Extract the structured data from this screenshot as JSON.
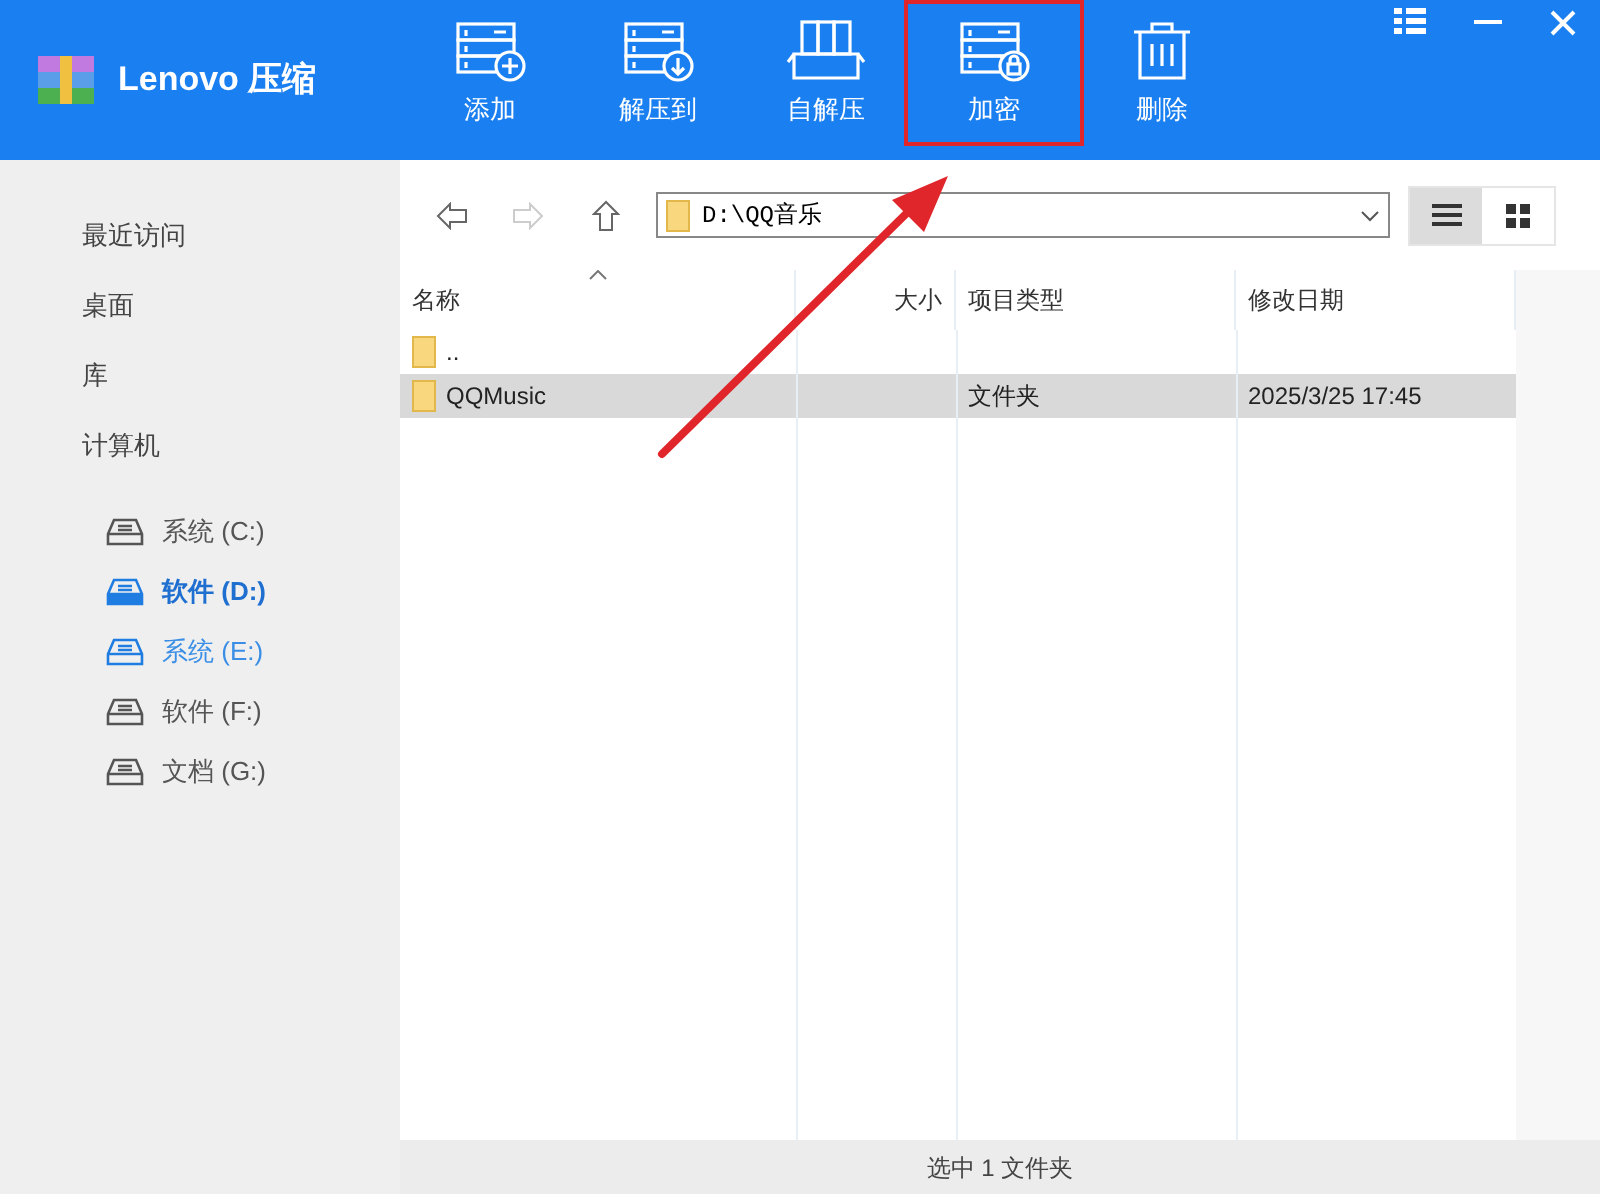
{
  "app": {
    "title": "Lenovo 压缩"
  },
  "toolbar": [
    {
      "kind": "add",
      "label": "添加",
      "highlighted": false
    },
    {
      "kind": "extract",
      "label": "解压到",
      "highlighted": false
    },
    {
      "kind": "sfx",
      "label": "自解压",
      "highlighted": false
    },
    {
      "kind": "encrypt",
      "label": "加密",
      "highlighted": true
    },
    {
      "kind": "delete",
      "label": "删除",
      "highlighted": false
    }
  ],
  "sidebar": {
    "items": [
      "最近访问",
      "桌面",
      "库",
      "计算机"
    ],
    "drives": [
      {
        "label": "系统 (C:)",
        "selected": false,
        "hovered": false
      },
      {
        "label": "软件 (D:)",
        "selected": true,
        "hovered": false
      },
      {
        "label": "系统 (E:)",
        "selected": false,
        "hovered": true
      },
      {
        "label": "软件 (F:)",
        "selected": false,
        "hovered": false
      },
      {
        "label": "文档 (G:)",
        "selected": false,
        "hovered": false
      }
    ]
  },
  "path": {
    "value": "D:\\QQ音乐"
  },
  "view": [
    {
      "kind": "list",
      "selected": true
    },
    {
      "kind": "grid",
      "selected": false
    }
  ],
  "table": {
    "columns": [
      {
        "label": "名称",
        "sorted": true
      },
      {
        "label": "大小",
        "sorted": false
      },
      {
        "label": "项目类型",
        "sorted": false
      },
      {
        "label": "修改日期",
        "sorted": false
      }
    ],
    "rows": [
      {
        "name": "..",
        "selected": false
      },
      {
        "name": "QQMusic",
        "type": "文件夹",
        "date": "2025/3/25 17:45",
        "selected": true
      }
    ]
  },
  "annotation": {
    "arrow": true
  },
  "status_bar": "选中 1 文件夹"
}
